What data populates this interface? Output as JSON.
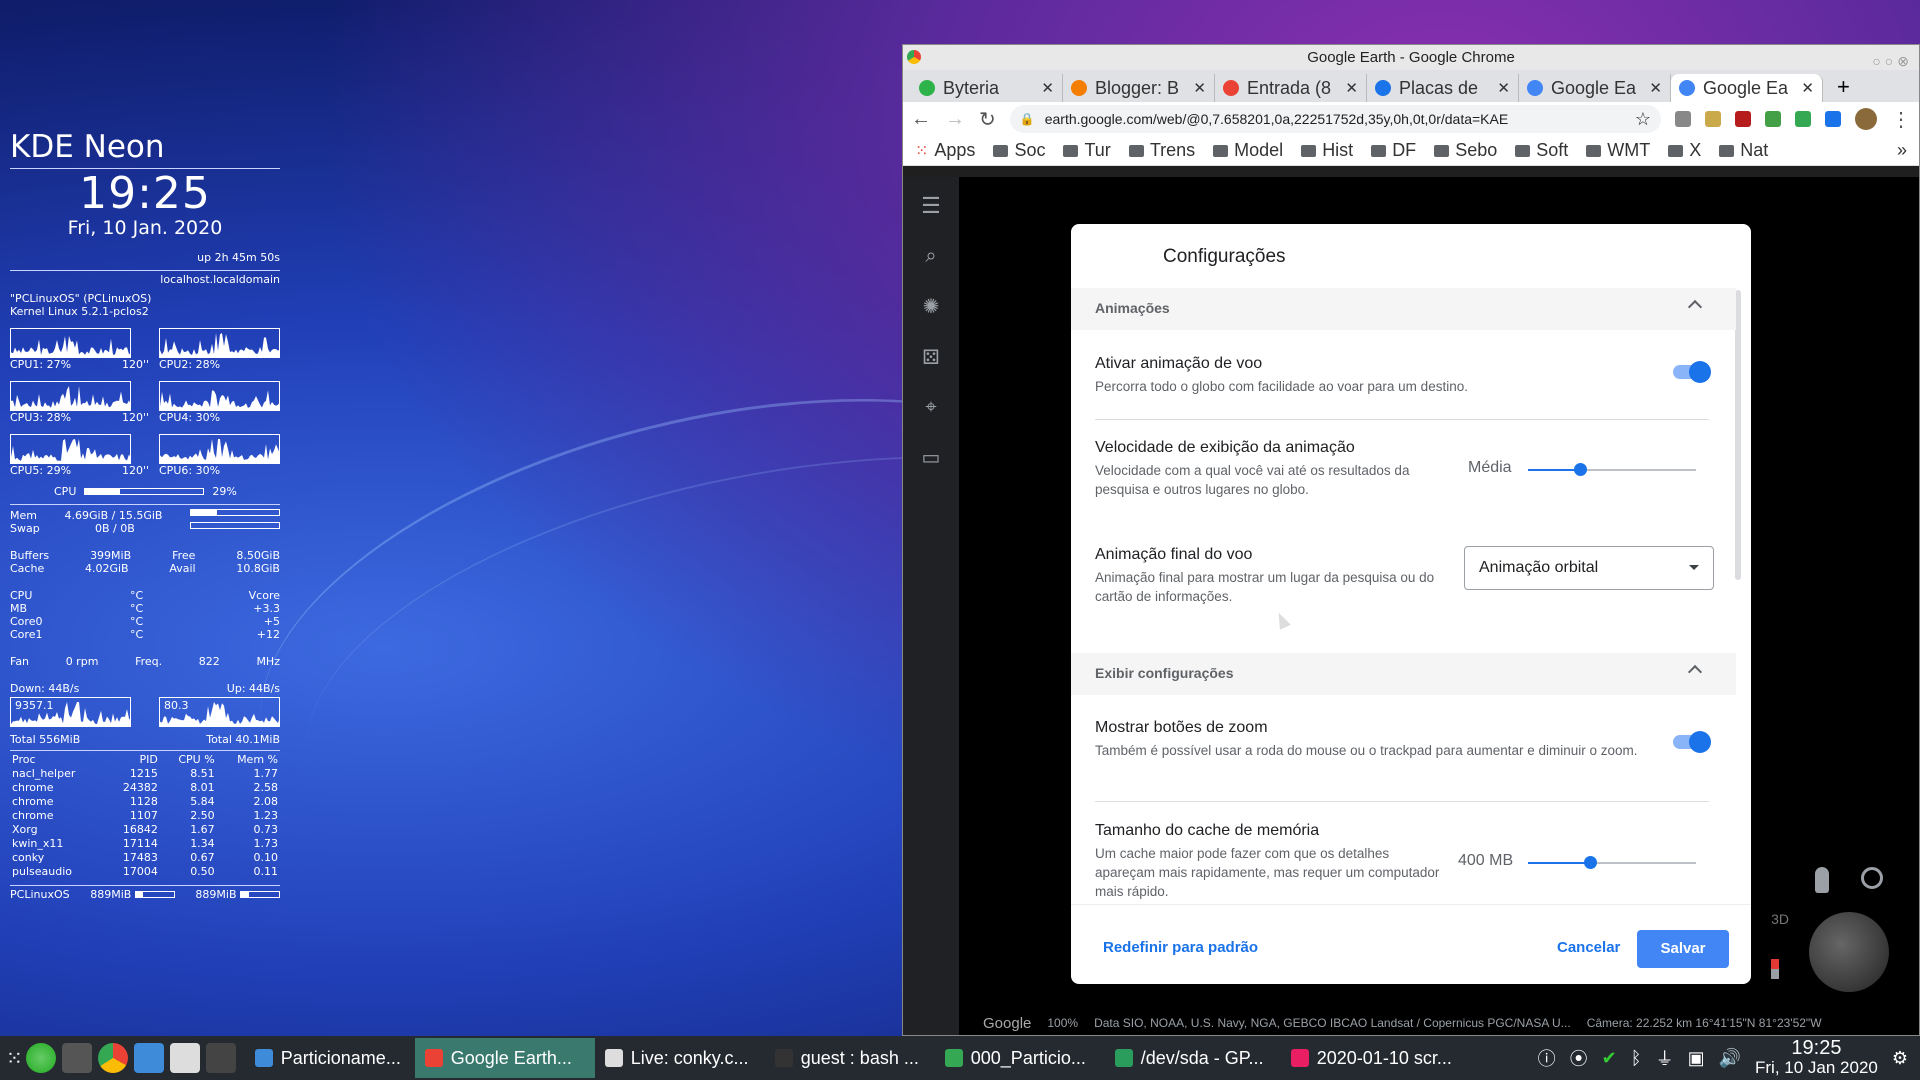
{
  "conky": {
    "title": "KDE Neon",
    "time": "19:25",
    "date": "Fri, 10 Jan. 2020",
    "uptime": "up  2h 45m 50s",
    "host": "localhost.localdomain",
    "os": "\"PCLinuxOS\" (PCLinuxOS)",
    "kernel": "Kernel Linux 5.2.1-pclos2",
    "cpus": [
      {
        "label": "CPU1: 27%",
        "temp": "120''"
      },
      {
        "label": "CPU2: 28%",
        "temp": ""
      },
      {
        "label": "CPU3: 28%",
        "temp": "120''"
      },
      {
        "label": "CPU4: 30%",
        "temp": ""
      },
      {
        "label": "CPU5: 29%",
        "temp": "120''"
      },
      {
        "label": "CPU6: 30%",
        "temp": ""
      }
    ],
    "cpu_total_label": "CPU",
    "cpu_total": "29%",
    "cpu_total_frac": 0.29,
    "mem_label": "Mem",
    "mem": "4.69GiB / 15.5GiB",
    "mem_frac": 0.3,
    "swap_label": "Swap",
    "swap": "0B / 0B",
    "buffers_label": "Buffers",
    "buffers": "399MiB",
    "free_label": "Free",
    "free": "8.50GiB",
    "cache_label": "Cache",
    "cache": "4.02GiB",
    "avail_label": "Avail",
    "avail": "10.8GiB",
    "sensors": [
      [
        "CPU",
        "°C",
        "Vcore"
      ],
      [
        "MB",
        "°C",
        "+3.3"
      ],
      [
        "Core0",
        "°C",
        "+5"
      ],
      [
        "Core1",
        "°C",
        "+12"
      ]
    ],
    "fan_label": "Fan",
    "fan": "0 rpm",
    "freq_label": "Freq.",
    "freq": "822",
    "freq_unit": "MHz",
    "down": "Down: 44B/s",
    "up": "Up: 44B/s",
    "down_peak": "9357.1",
    "up_peak": "80.3",
    "total_down": "Total 556MiB",
    "total_up": "Total 40.1MiB",
    "proc_head": [
      "Proc",
      "PID",
      "CPU %",
      "Mem %"
    ],
    "procs": [
      [
        "nacl_helper",
        "1215",
        "8.51",
        "1.77"
      ],
      [
        "chrome",
        "24382",
        "8.01",
        "2.58"
      ],
      [
        "chrome",
        "1128",
        "5.84",
        "2.08"
      ],
      [
        "chrome",
        "1107",
        "2.50",
        "1.23"
      ],
      [
        "Xorg",
        "16842",
        "1.67",
        "0.73"
      ],
      [
        "kwin_x11",
        "17114",
        "1.34",
        "1.73"
      ],
      [
        "conky",
        "17483",
        "0.67",
        "0.10"
      ],
      [
        "pulseaudio",
        "17004",
        "0.50",
        "0.11"
      ]
    ],
    "footer_left": "PCLinuxOS",
    "disk1": "889MiB",
    "disk2": "889MiB"
  },
  "window": {
    "title": "Google Earth - Google Chrome"
  },
  "tabs": [
    {
      "label": "Byteria",
      "color": "#2db34a"
    },
    {
      "label": "Blogger: B",
      "color": "#f57d00"
    },
    {
      "label": "Entrada (8",
      "color": "#ea4335"
    },
    {
      "label": "Placas de",
      "color": "#1a73e8"
    },
    {
      "label": "Google Ea",
      "color": "#4285f4"
    },
    {
      "label": "Google Ea",
      "color": "#4285f4"
    }
  ],
  "url": "earth.google.com/web/@0,7.658201,0a,22251752d,35y,0h,0t,0r/data=KAE",
  "bookmarks": [
    "Apps",
    "Soc",
    "Tur",
    "Trens",
    "Model",
    "Hist",
    "DF",
    "Sebo",
    "Soft",
    "WMT",
    "X",
    "Nat"
  ],
  "dialog": {
    "title": "Configurações",
    "sec1": "Animações",
    "s1_title": "Ativar animação de voo",
    "s1_desc": "Percorra todo o globo com facilidade ao voar para um destino.",
    "s1_on": true,
    "s2_title": "Velocidade de exibição da animação",
    "s2_desc": "Velocidade com a qual você vai até os resultados da pesquisa e outros lugares no globo.",
    "s2_value": "Média",
    "s2_frac": 0.31,
    "s3_title": "Animação final do voo",
    "s3_desc": "Animação final para mostrar um lugar da pesquisa ou do cartão de informações.",
    "s3_value": "Animação orbital",
    "sec2": "Exibir configurações",
    "s4_title": "Mostrar botões de zoom",
    "s4_desc": "Também é possível usar a roda do mouse ou o trackpad para aumentar e diminuir o zoom.",
    "s4_on": true,
    "s5_title": "Tamanho do cache de memória",
    "s5_desc": "Um cache maior pode fazer com que os detalhes apareçam mais rapidamente, mas requer um computador mais rápido.",
    "s5_value": "400 MB",
    "s5_frac": 0.37,
    "reset": "Redefinir para padrão",
    "cancel": "Cancelar",
    "save": "Salvar"
  },
  "earth_status": {
    "brand": "Google",
    "zoom": "100%",
    "credits": "Data SIO, NOAA, U.S. Navy, NGA, GEBCO  IBCAO  Landsat / Copernicus  PGC/NASA  U...",
    "camera": "Câmera: 22.252 km  16°41'15\"N 81°23'52\"W",
    "view3d": "3D"
  },
  "taskbar": {
    "tasks": [
      "Particioname...",
      "Google Earth...",
      "Live: conky.c...",
      "guest : bash ...",
      "000_Particio...",
      "/dev/sda - GP...",
      "2020-01-10 scr..."
    ],
    "time": "19:25",
    "date": "Fri, 10 Jan 2020"
  }
}
